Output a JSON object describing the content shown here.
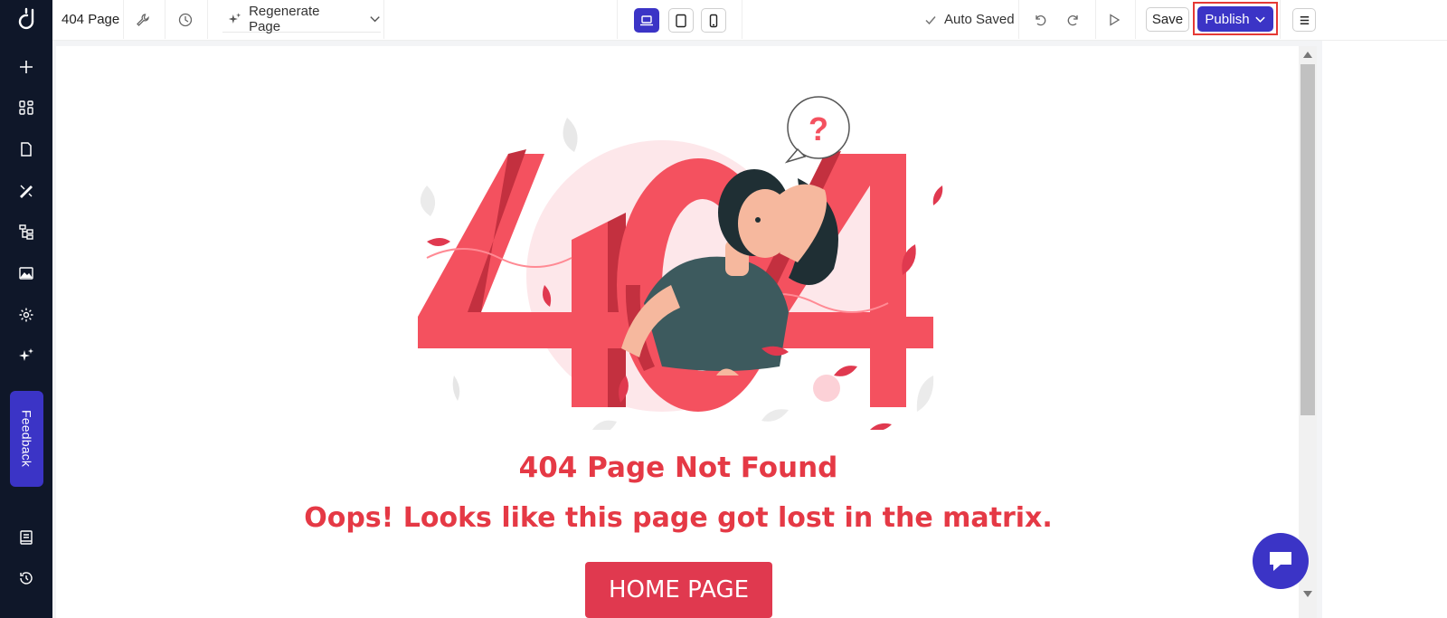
{
  "topbar": {
    "page_name": "404 Page",
    "regenerate_label": "Regenerate Page",
    "autosave_label": "Auto Saved",
    "save_label": "Save",
    "publish_label": "Publish",
    "active_device": "desktop"
  },
  "sidebar": {
    "feedback_label": "Feedback",
    "items": [
      "plus-icon",
      "grid-icon",
      "page-icon",
      "design-tools-icon",
      "sitemap-icon",
      "image-icon",
      "gear-icon",
      "ai-sparkle-icon"
    ],
    "bottom_items": [
      "book-icon",
      "history-icon"
    ]
  },
  "page": {
    "illustration_text": "404",
    "title": "404 Page Not Found",
    "subtitle": "Oops! Looks like this page got lost in the matrix.",
    "button_label": "HOME PAGE"
  },
  "colors": {
    "brand": "#3b34c6",
    "sidebar_bg": "#0f1729",
    "error_red": "#e53945",
    "highlight": "#e53935"
  }
}
